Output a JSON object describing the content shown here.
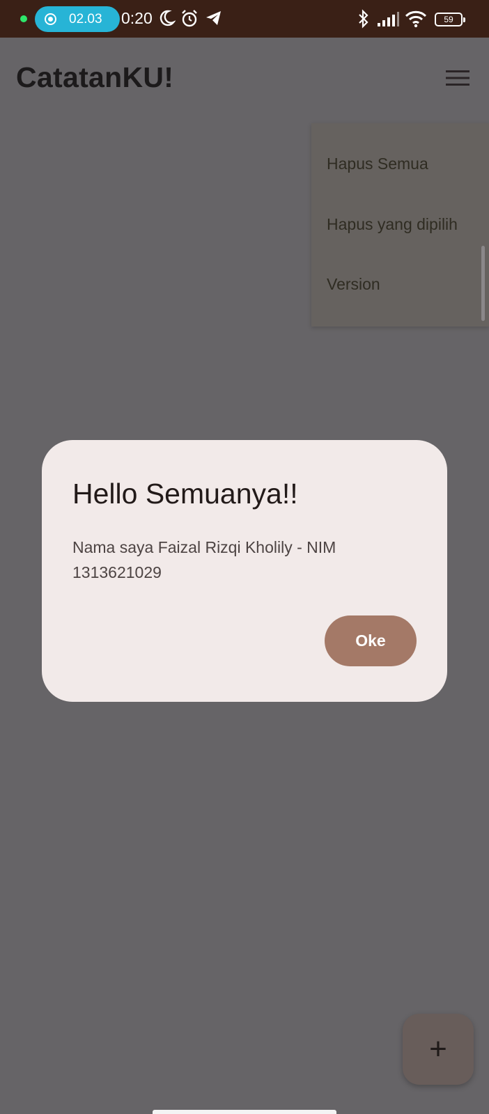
{
  "status_bar": {
    "recording_time": "02.03",
    "clock": "0:20",
    "battery": "59",
    "icons": [
      "recording-dot-icon",
      "record-icon",
      "moon-icon",
      "alarm-icon",
      "telegram-icon",
      "bluetooth-icon",
      "signal-icon",
      "wifi-icon",
      "battery-icon"
    ]
  },
  "app_bar": {
    "title": "CatatanKU!",
    "menu_icon": "hamburger-menu-icon"
  },
  "popup_menu": {
    "items": [
      {
        "label": "Hapus Semua"
      },
      {
        "label": "Hapus yang dipilih"
      },
      {
        "label": "Version"
      }
    ]
  },
  "dialog": {
    "title": "Hello Semuanya!!",
    "message": "Nama saya Faizal Rizqi Kholily - NIM 1313621029",
    "ok_label": "Oke"
  },
  "fab": {
    "icon": "plus-icon",
    "symbol": "+"
  },
  "colors": {
    "status_bar": "#3a2016",
    "scrim": "#666467",
    "dialog_bg": "#f2eae9",
    "ok_button": "#a47967",
    "recording_pill": "#27b4d6"
  }
}
